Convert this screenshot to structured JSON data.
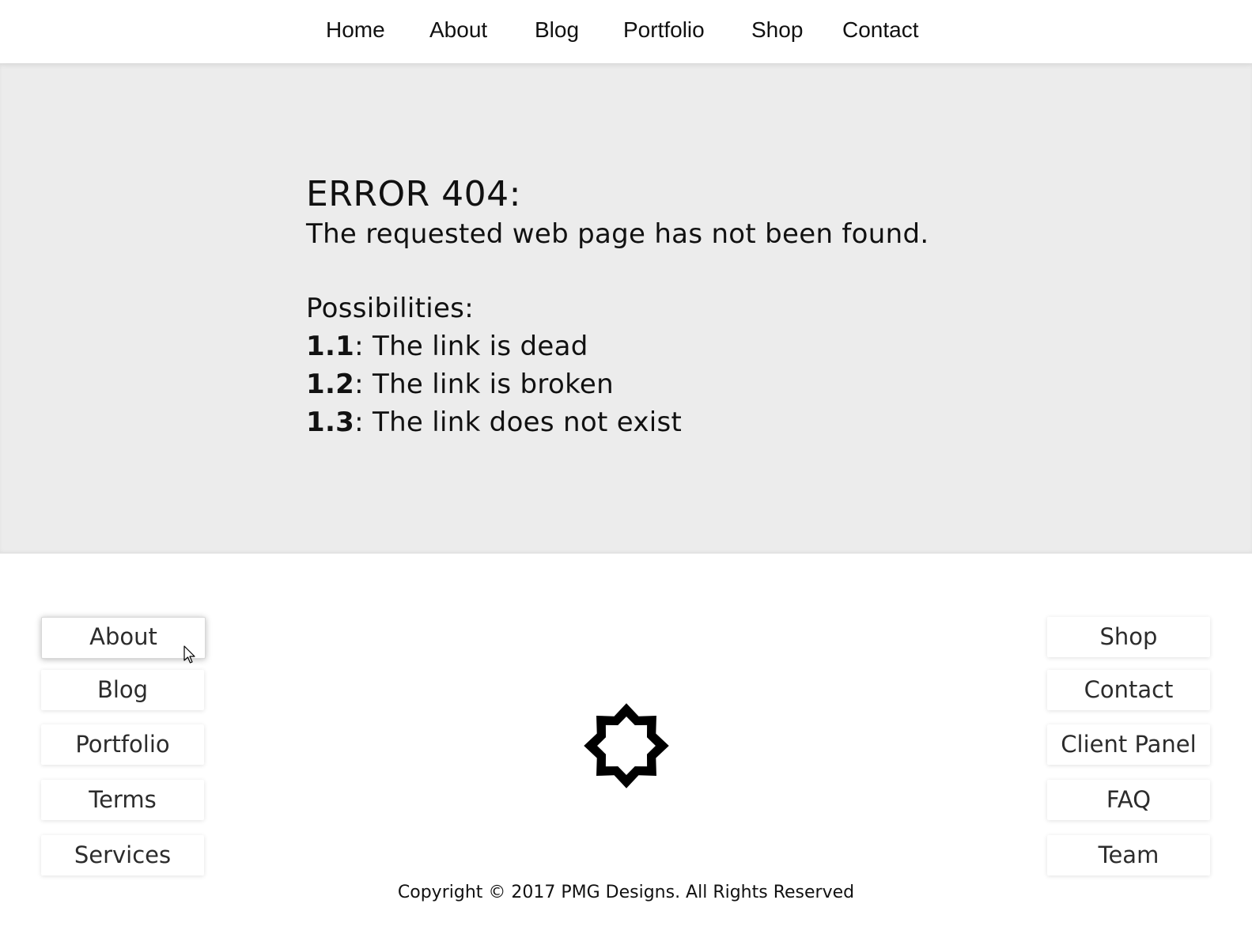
{
  "topnav": {
    "items": [
      "Home",
      "About",
      "Blog",
      "Portfolio",
      "Shop",
      "Contact"
    ]
  },
  "error": {
    "title": "ERROR 404:",
    "message": "The requested web page has not been found.",
    "possibilities_label": "Possibilities:",
    "items": [
      {
        "num": "1.1",
        "text": ": The link is dead"
      },
      {
        "num": "1.2",
        "text": ": The link is broken"
      },
      {
        "num": "1.3",
        "text": ": The link does not exist"
      }
    ]
  },
  "footer": {
    "left_links": [
      "About",
      "Blog",
      "Portfolio",
      "Terms",
      "Services"
    ],
    "right_links": [
      "Shop",
      "Contact",
      "Client Panel",
      "FAQ",
      "Team"
    ],
    "logo_icon": "eight-point-star-icon",
    "copyright": "Copyright © 2017 PMG Designs. All Rights Reserved"
  },
  "colors": {
    "main_bg": "#ececec",
    "text": "#111111"
  }
}
